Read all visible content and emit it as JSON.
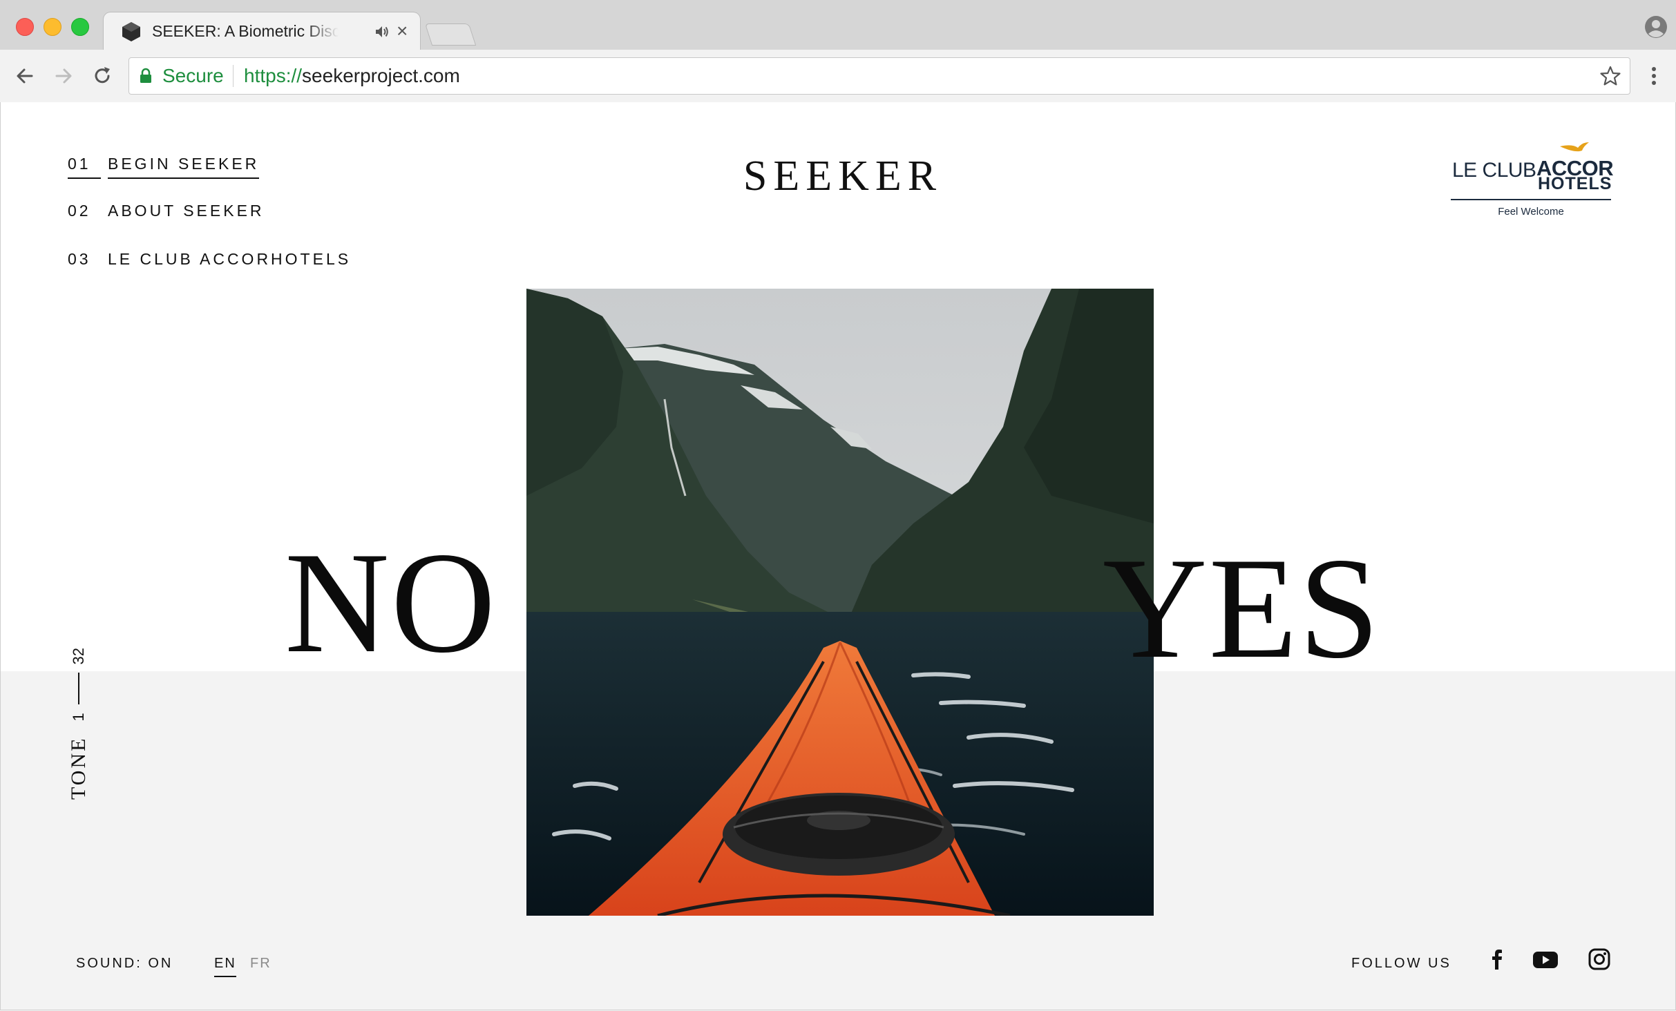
{
  "browser": {
    "tab_title": "SEEKER: A Biometric Discovery",
    "tab_close": "×",
    "address": {
      "secure_label": "Secure",
      "url_scheme": "https://",
      "url_host": "seekerproject.com"
    }
  },
  "site": {
    "nav": [
      {
        "number": "01",
        "label": "BEGIN SEEKER",
        "active": true
      },
      {
        "number": "02",
        "label": "ABOUT SEEKER",
        "active": false
      },
      {
        "number": "03",
        "label": "LE CLUB ACCORHOTELS",
        "active": false
      }
    ],
    "brand": "SEEKER",
    "partner_logo": {
      "le_club": "LE CLUB",
      "accor": "ACCOR",
      "hotels": "HOTELS",
      "tagline": "Feel Welcome"
    },
    "answers": {
      "no": "NO",
      "yes": "YES"
    },
    "tone": {
      "label": "TONE",
      "current": "1",
      "total": "32"
    },
    "footer": {
      "sound": "SOUND: ON",
      "lang_en": "EN",
      "lang_fr": "FR",
      "follow": "FOLLOW US"
    },
    "social": [
      "facebook-icon",
      "youtube-icon",
      "instagram-icon"
    ]
  },
  "colors": {
    "lower_band": "#f3f3f3",
    "secure_green": "#1e8e3e",
    "logo_navy": "#1b2a3d",
    "logo_gold": "#e6a21a",
    "kayak_orange": "#e8501f"
  }
}
